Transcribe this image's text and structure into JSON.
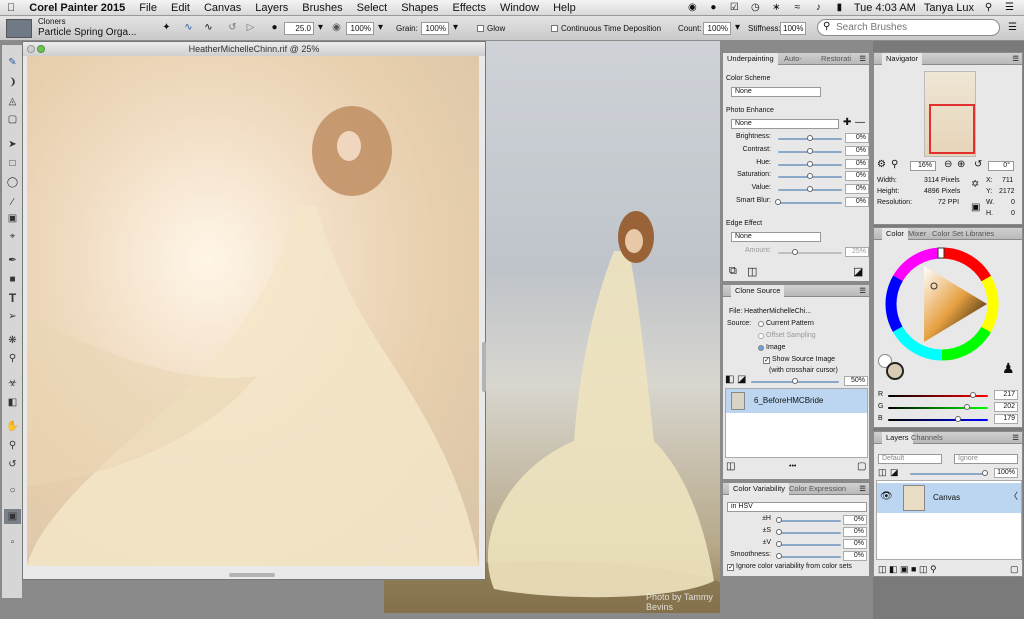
{
  "menubar": {
    "app_name": "Corel Painter 2015",
    "items": [
      "File",
      "Edit",
      "Canvas",
      "Layers",
      "Brushes",
      "Select",
      "Shapes",
      "Effects",
      "Window",
      "Help"
    ],
    "clock": "Tue 4:03 AM",
    "user": "Tanya Lux"
  },
  "brush_selector": {
    "category": "Cloners",
    "variant": "Particle Spring Orga..."
  },
  "property_bar": {
    "size": "25.0",
    "opacity": "100%",
    "grain_label": "Grain:",
    "grain": "100%",
    "glow_label": "Glow",
    "continuous_label": "Continuous Time Deposition",
    "count_label": "Count:",
    "count": "100%",
    "stiffness_label": "Stiffness:",
    "stiffness": "100%",
    "search_placeholder": "Search Brushes"
  },
  "document": {
    "title": "HeatherMichelleChinn.rif @ 25%"
  },
  "photo_credit": "Photo by Tammy Bevins",
  "underpainting": {
    "tabs": [
      "Underpainting",
      "Auto-",
      "Restorati"
    ],
    "color_scheme_label": "Color Scheme",
    "color_scheme": "None",
    "photo_enhance_label": "Photo Enhance",
    "photo_enhance": "None",
    "sliders": [
      {
        "label": "Brightness:",
        "value": "0%"
      },
      {
        "label": "Contrast:",
        "value": "0%"
      },
      {
        "label": "Hue:",
        "value": "0%"
      },
      {
        "label": "Saturation:",
        "value": "0%"
      },
      {
        "label": "Value:",
        "value": "0%"
      },
      {
        "label": "Smart Blur:",
        "value": "0%"
      }
    ],
    "edge_effect_label": "Edge Effect",
    "edge_effect": "None",
    "amount_label": "Amount:",
    "amount": "25%"
  },
  "clone_source": {
    "title": "Clone Source",
    "file": "File: HeatherMichelleChi...",
    "source_label": "Source:",
    "options": [
      "Current Pattern",
      "Offset Sampling",
      "Image"
    ],
    "show_source": "Show Source Image",
    "crosshair": "(with crosshair cursor)",
    "opacity": "50%",
    "item": "6_BeforeHMCBride"
  },
  "color_variability": {
    "tabs": [
      "Color Variability",
      "Color Expression"
    ],
    "mode": "in HSV",
    "rows": [
      {
        "label": "±H",
        "value": "0%"
      },
      {
        "label": "±S",
        "value": "0%"
      },
      {
        "label": "±V",
        "value": "0%"
      },
      {
        "label": "Smoothness:",
        "value": "0%"
      }
    ],
    "ignore": "Ignore color variability from color sets"
  },
  "navigator": {
    "title": "Navigator",
    "zoom": "16%",
    "rotation": "0°",
    "width_label": "Width:",
    "width": "3114 Pixels",
    "height_label": "Height:",
    "height": "4896 Pixels",
    "resolution_label": "Resolution:",
    "resolution": "72 PPI",
    "x_label": "X:",
    "x": "711",
    "y_label": "Y:",
    "y": "2172",
    "w_label": "W.",
    "w": "0",
    "h_label": "H.",
    "h": "0"
  },
  "color_panel": {
    "tabs": [
      "Color",
      "Mixer",
      "Color Set Libraries"
    ],
    "r_label": "R",
    "r": "217",
    "g_label": "G",
    "g": "202",
    "b_label": "B",
    "b": "179",
    "current": "#d9cab3"
  },
  "layers_panel": {
    "tabs": [
      "Layers",
      "Channels"
    ],
    "composite": "Default",
    "ignore": "Ignore",
    "opacity": "100%",
    "layer": "Canvas"
  }
}
